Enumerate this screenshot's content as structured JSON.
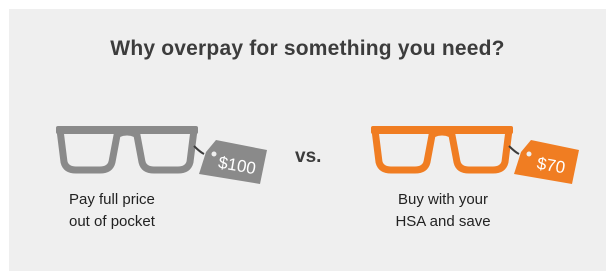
{
  "headline": "Why overpay for something you need?",
  "left_option": {
    "price_tag": "$100",
    "caption": "Pay full price\nout of pocket",
    "color": "#8a8a8a",
    "icon": "glasses-icon"
  },
  "separator": "vs.",
  "right_option": {
    "price_tag": "$70",
    "caption": "Buy with your\nHSA and save",
    "color": "#f07d22",
    "icon": "glasses-icon"
  },
  "colors": {
    "panel_background": "#efefef",
    "headline_text": "#3c3c3c"
  }
}
